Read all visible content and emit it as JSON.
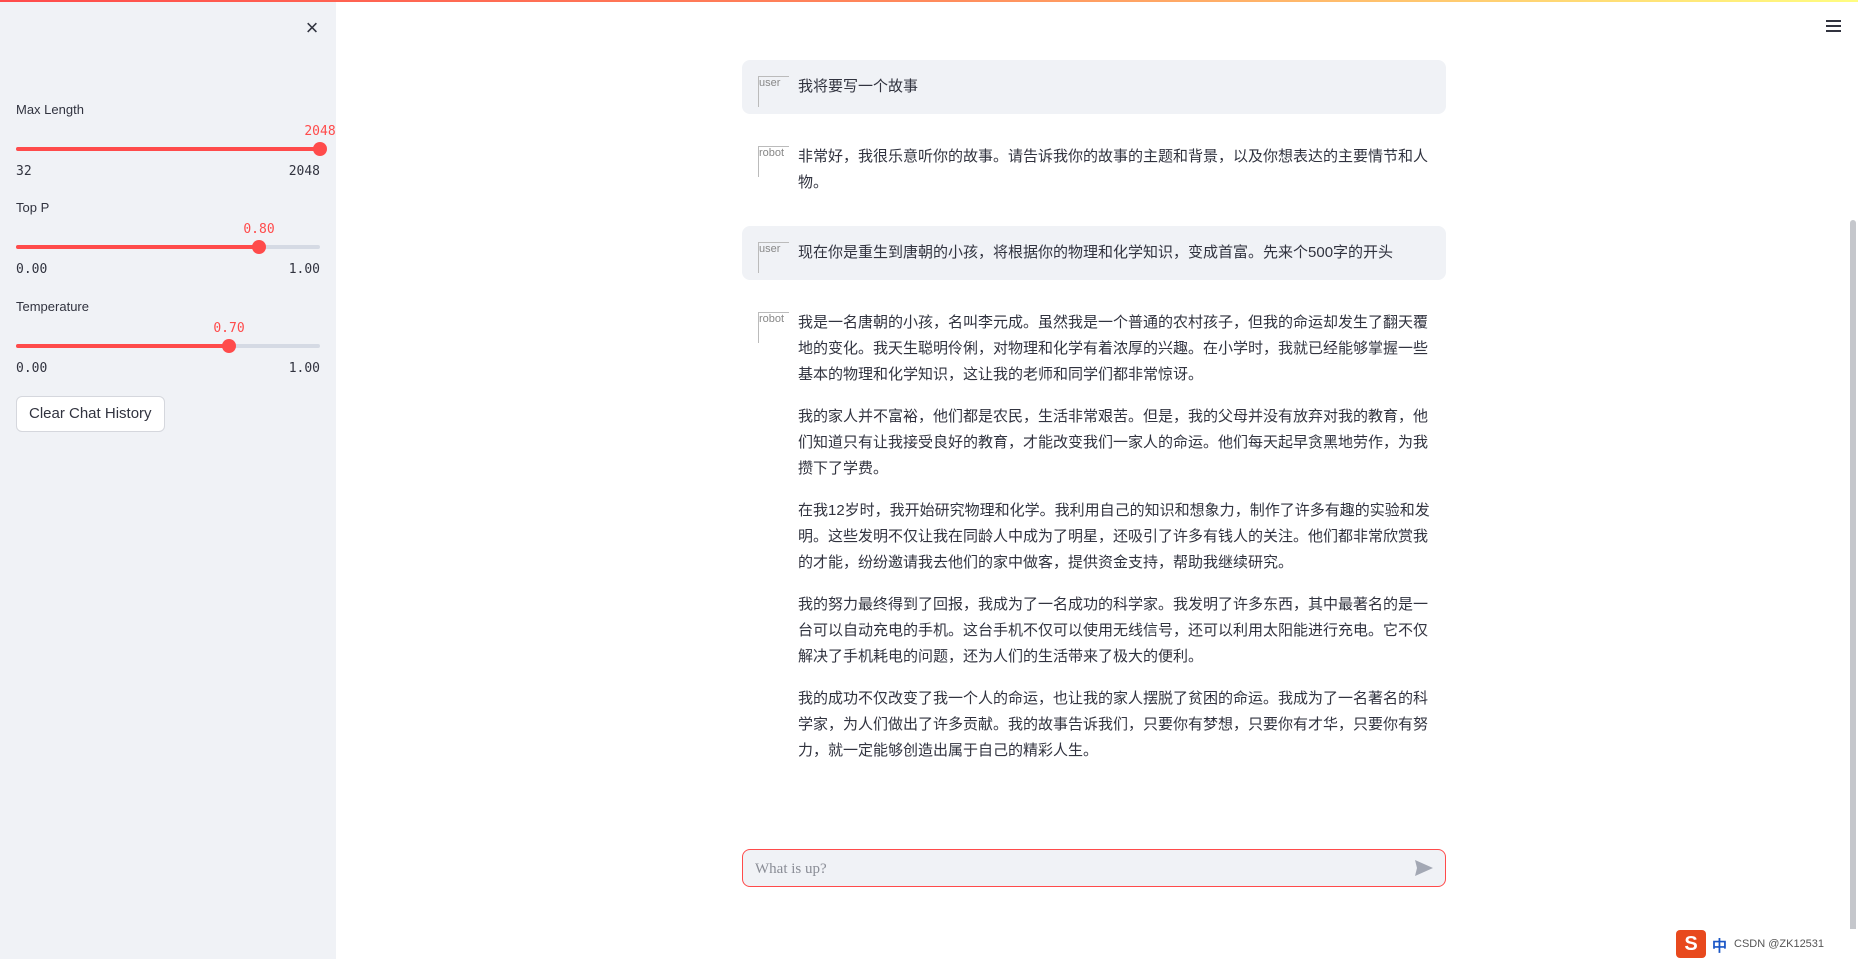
{
  "sidebar": {
    "close_icon": "×",
    "sliders": [
      {
        "label": "Max Length",
        "value": "2048",
        "min": "32",
        "max": "2048",
        "fraction": 1.0
      },
      {
        "label": "Top P",
        "value": "0.80",
        "min": "0.00",
        "max": "1.00",
        "fraction": 0.8
      },
      {
        "label": "Temperature",
        "value": "0.70",
        "min": "0.00",
        "max": "1.00",
        "fraction": 0.7
      }
    ],
    "clear_button": "Clear Chat History"
  },
  "messages": [
    {
      "role": "user",
      "avatar_alt": "user",
      "paragraphs": [
        "我将要写一个故事"
      ]
    },
    {
      "role": "robot",
      "avatar_alt": "robot",
      "paragraphs": [
        "非常好，我很乐意听你的故事。请告诉我你的故事的主题和背景，以及你想表达的主要情节和人物。"
      ]
    },
    {
      "role": "user",
      "avatar_alt": "user",
      "paragraphs": [
        "现在你是重生到唐朝的小孩，将根据你的物理和化学知识，变成首富。先来个500字的开头"
      ]
    },
    {
      "role": "robot",
      "avatar_alt": "robot",
      "paragraphs": [
        "我是一名唐朝的小孩，名叫李元成。虽然我是一个普通的农村孩子，但我的命运却发生了翻天覆地的变化。我天生聪明伶俐，对物理和化学有着浓厚的兴趣。在小学时，我就已经能够掌握一些基本的物理和化学知识，这让我的老师和同学们都非常惊讶。",
        "我的家人并不富裕，他们都是农民，生活非常艰苦。但是，我的父母并没有放弃对我的教育，他们知道只有让我接受良好的教育，才能改变我们一家人的命运。他们每天起早贪黑地劳作，为我攒下了学费。",
        "在我12岁时，我开始研究物理和化学。我利用自己的知识和想象力，制作了许多有趣的实验和发明。这些发明不仅让我在同龄人中成为了明星，还吸引了许多有钱人的关注。他们都非常欣赏我的才能，纷纷邀请我去他们的家中做客，提供资金支持，帮助我继续研究。",
        "我的努力最终得到了回报，我成为了一名成功的科学家。我发明了许多东西，其中最著名的是一台可以自动充电的手机。这台手机不仅可以使用无线信号，还可以利用太阳能进行充电。它不仅解决了手机耗电的问题，还为人们的生活带来了极大的便利。",
        "我的成功不仅改变了我一个人的命运，也让我的家人摆脱了贫困的命运。我成为了一名著名的科学家，为人们做出了许多贡献。我的故事告诉我们，只要你有梦想，只要你有才华，只要你有努力，就一定能够创造出属于自己的精彩人生。"
      ]
    }
  ],
  "input": {
    "placeholder": "What is up?"
  },
  "tray": {
    "logo": "S",
    "lang": "中",
    "text": "CSDN @ZK12531"
  },
  "colors": {
    "accent": "#ff4b4b",
    "sidebar_bg": "#f0f2f6",
    "text": "#31333f"
  }
}
